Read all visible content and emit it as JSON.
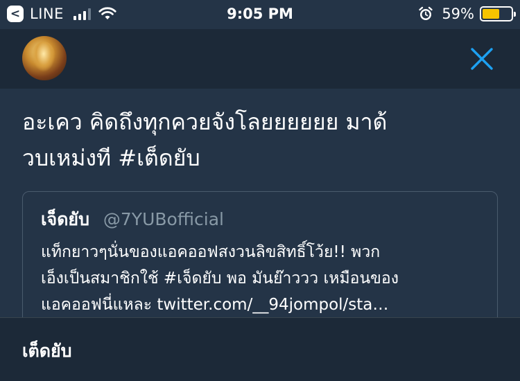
{
  "status_bar": {
    "back_glyph": "<",
    "app_name": "LINE",
    "time": "9:05 PM",
    "battery_percent": "59%",
    "battery_level": 0.59,
    "signal_bars_active": 3,
    "signal_bars_total": 4,
    "icons": [
      "back-icon",
      "signal-icon",
      "wifi-icon",
      "alarm-icon",
      "battery-icon"
    ]
  },
  "header": {
    "avatar_alt": "profile avatar",
    "close_icon": "close-icon",
    "accent_color": "#1da1f2"
  },
  "tweet": {
    "line1": "อะเคว คิดถึงทุกควยจังโลยยยยยย มาด้",
    "line2": "วบเหม่งที #เต็ดยับ"
  },
  "quote": {
    "name": "เจ็ดยับ",
    "handle": "@7YUBofficial",
    "line1": "แท็กยาวๆนั่นของแอคออฟสงวนลิขสิทธิ์โว้ย!! พวก",
    "line2": "เอ็งเป็นสมาชิกใช้ #เจ็ดยับ พอ มันย๊าววว เหมือนของ",
    "line3": "แอคออฟนี่แหละ twitter.com/__94jompol/sta…"
  },
  "bottom": {
    "label": "เต็ดยับ"
  },
  "colors": {
    "background": "#243447",
    "header_background": "#1c2938",
    "handle_gray": "#8899a6",
    "battery_yellow": "#f5c400"
  }
}
